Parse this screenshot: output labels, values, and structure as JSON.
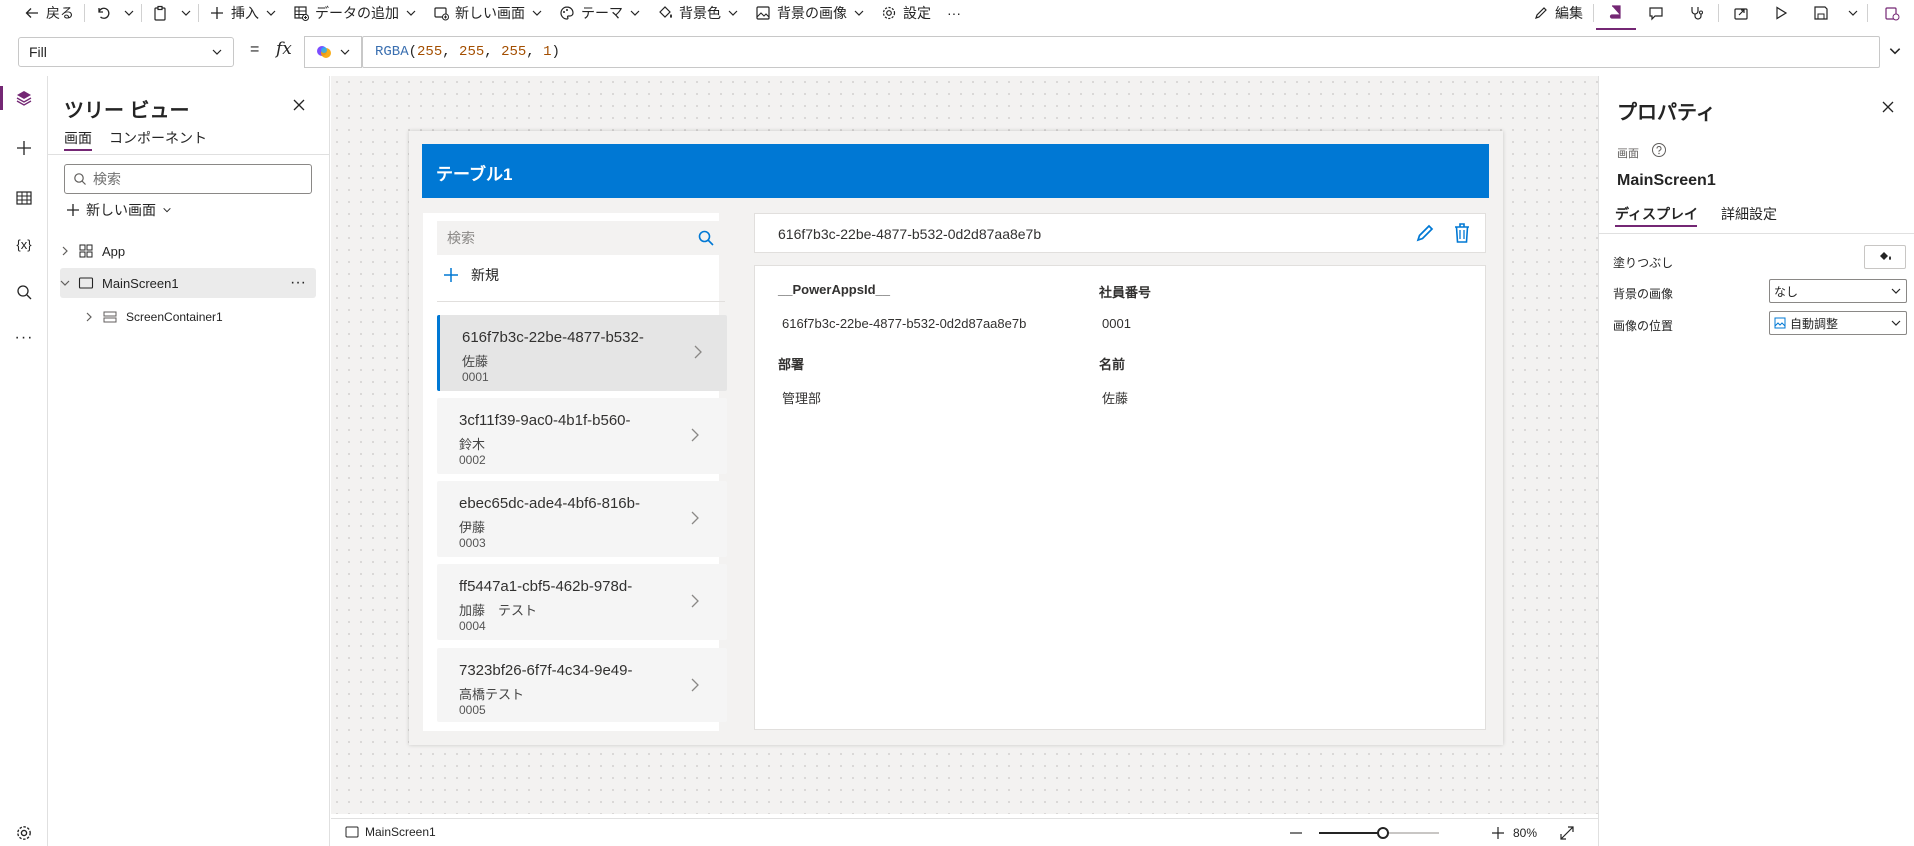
{
  "toolbar": {
    "back": "戻る",
    "insert": "挿入",
    "add_data": "データの追加",
    "new_screen": "新しい画面",
    "theme": "テーマ",
    "bg_color": "背景色",
    "bg_image": "背景の画像",
    "settings": "設定",
    "more": "···",
    "edit": "編集"
  },
  "formula": {
    "property": "Fill",
    "equals": "=",
    "fx": "fx",
    "fn": "RGBA",
    "open": "(",
    "a1": "255",
    "a2": "255",
    "a3": "255",
    "a4": "1",
    "close": ")",
    "comma": ", "
  },
  "tree": {
    "title": "ツリー ビュー",
    "tab_screens": "画面",
    "tab_components": "コンポーネント",
    "search_placeholder": "検索",
    "new_screen": "新しい画面",
    "items": {
      "app": "App",
      "main_screen": "MainScreen1",
      "container": "ScreenContainer1"
    }
  },
  "app_screen": {
    "header_title": "テーブル1",
    "search_placeholder": "検索",
    "new_label": "新規",
    "list": [
      {
        "id": "616f7b3c-22be-4877-b532-",
        "name": "佐藤",
        "code": "0001"
      },
      {
        "id": "3cf11f39-9ac0-4b1f-b560-",
        "name": "鈴木",
        "code": "0002"
      },
      {
        "id": "ebec65dc-ade4-4bf6-816b-",
        "name": "伊藤",
        "code": "0003"
      },
      {
        "id": "ff5447a1-cbf5-462b-978d-",
        "name": "加藤　テスト",
        "code": "0004"
      },
      {
        "id": "7323bf26-6f7f-4c34-9e49-",
        "name": "高橋テスト",
        "code": "0005"
      }
    ],
    "detail_title": "616f7b3c-22be-4877-b532-0d2d87aa8e7b",
    "fields": {
      "powerapps_id_label": "__PowerAppsId__",
      "powerapps_id_value": "616f7b3c-22be-4877-b532-0d2d87aa8e7b",
      "emp_no_label": "社員番号",
      "emp_no_value": "0001",
      "dept_label": "部署",
      "dept_value": "管理部",
      "name_label": "名前",
      "name_value": "佐藤"
    }
  },
  "status": {
    "screen_name": "MainScreen1",
    "zoom": "80%"
  },
  "props": {
    "title": "プロパティ",
    "section": "画面",
    "screen_name": "MainScreen1",
    "tab_display": "ディスプレイ",
    "tab_advanced": "詳細設定",
    "fill_label": "塗りつぶし",
    "bg_image_label": "背景の画像",
    "bg_image_value": "なし",
    "img_pos_label": "画像の位置",
    "img_pos_value": "自動調整"
  },
  "colors": {
    "accent_purple": "#742774",
    "app_blue": "#0078d4",
    "canvas": "#f3f2f1"
  }
}
